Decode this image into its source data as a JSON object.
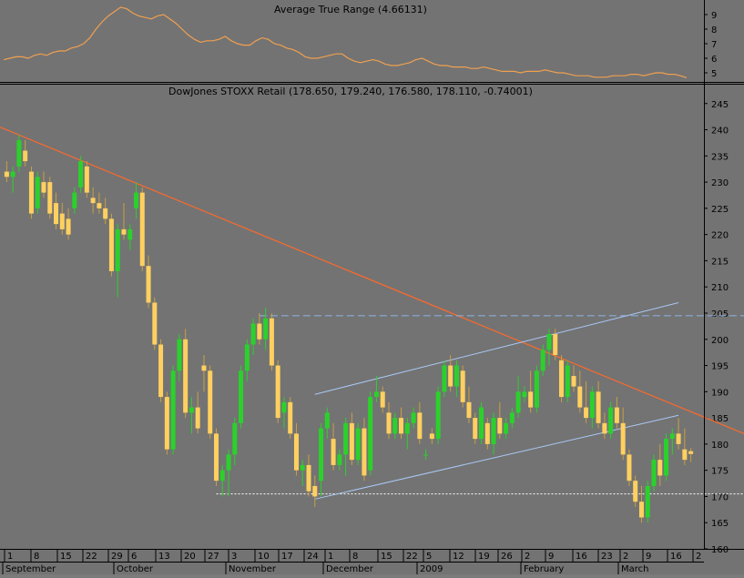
{
  "colors": {
    "background": "#737373",
    "atr_line": "#f0a050",
    "up_candle": "#2bd12b",
    "down_candle": "#ffd060",
    "trendline": "#ff6a2a",
    "channel": "#a9c8f5",
    "resistance": "#8db4e6",
    "support": "#ffffff",
    "axis_text": "#000000"
  },
  "atr_panel": {
    "title": "Average True Range (4.66131)",
    "ticks": [
      "9",
      "8",
      "7",
      "6",
      "5"
    ]
  },
  "price_panel": {
    "title": "DowJones STOXX Retail (178.650, 179.240, 176.580, 178.110, -0.74001)",
    "ticks": [
      "245",
      "240",
      "235",
      "230",
      "225",
      "220",
      "215",
      "210",
      "205",
      "200",
      "195",
      "190",
      "185",
      "180",
      "175",
      "170",
      "165",
      "160"
    ]
  },
  "x_axis": {
    "day_labels": [
      "1",
      "8",
      "15",
      "22",
      "29",
      "6",
      "13",
      "20",
      "27",
      "3",
      "10",
      "17",
      "24",
      "1",
      "8",
      "15",
      "22",
      "5",
      "12",
      "19",
      "26",
      "2",
      "9",
      "16",
      "23",
      "2",
      "9",
      "16",
      "2"
    ],
    "month_labels": [
      "September",
      "October",
      "November",
      "December",
      "2009",
      "February",
      "March"
    ]
  },
  "chart_data": {
    "type": "candlestick",
    "title": "DowJones STOXX Retail (178.650, 179.240, 176.580, 178.110, -0.74001)",
    "last_bar": {
      "open": 178.65,
      "high": 179.24,
      "low": 176.58,
      "close": 178.11,
      "change": -0.74001
    },
    "y_range": [
      160,
      246
    ],
    "atr": {
      "title": "Average True Range (4.66131)",
      "last_value": 4.66131,
      "y_range": [
        4.5,
        9.5
      ],
      "values": [
        5.9,
        6.0,
        6.1,
        6.1,
        6.0,
        6.2,
        6.3,
        6.2,
        6.4,
        6.5,
        6.5,
        6.7,
        6.8,
        7.0,
        7.4,
        8.0,
        8.5,
        8.9,
        9.2,
        9.5,
        9.4,
        9.1,
        8.9,
        8.8,
        8.7,
        8.9,
        9.0,
        8.7,
        8.4,
        8.0,
        7.6,
        7.3,
        7.1,
        7.2,
        7.2,
        7.3,
        7.5,
        7.2,
        7.0,
        6.9,
        6.9,
        7.2,
        7.4,
        7.3,
        7.0,
        6.9,
        6.7,
        6.6,
        6.4,
        6.1,
        6.0,
        6.0,
        6.1,
        6.2,
        6.3,
        6.3,
        6.0,
        5.8,
        5.7,
        5.8,
        5.9,
        5.8,
        5.6,
        5.5,
        5.5,
        5.6,
        5.7,
        5.9,
        6.0,
        5.8,
        5.6,
        5.5,
        5.5,
        5.4,
        5.4,
        5.4,
        5.3,
        5.3,
        5.4,
        5.3,
        5.2,
        5.1,
        5.1,
        5.1,
        5.0,
        5.1,
        5.1,
        5.1,
        5.2,
        5.1,
        5.0,
        5.0,
        4.9,
        4.8,
        4.8,
        4.8,
        4.7,
        4.7,
        4.7,
        4.8,
        4.8,
        4.8,
        4.9,
        4.9,
        4.8,
        4.9,
        5.0,
        5.0,
        4.9,
        4.9,
        4.8,
        4.66
      ]
    },
    "trendline": {
      "start": 240.5,
      "end": 182.0
    },
    "resistance": 204.5,
    "support": 170.5,
    "channel_upper": {
      "start": 189.5,
      "end": 207.0
    },
    "channel_lower": {
      "start": 169.5,
      "end": 185.5
    },
    "candles": [
      [
        232,
        234,
        230,
        231
      ],
      [
        231,
        233,
        228,
        232
      ],
      [
        233,
        239,
        232,
        238
      ],
      [
        236,
        238,
        233,
        234
      ],
      [
        232,
        233,
        223,
        224
      ],
      [
        225,
        232,
        224,
        231
      ],
      [
        230,
        232,
        227,
        228
      ],
      [
        230,
        231,
        223,
        224
      ],
      [
        226,
        228,
        221,
        222
      ],
      [
        224,
        226,
        220,
        221
      ],
      [
        223,
        225,
        219,
        220
      ],
      [
        225,
        229,
        224,
        228
      ],
      [
        229,
        235,
        228,
        234
      ],
      [
        233,
        234,
        227,
        228
      ],
      [
        227,
        229,
        224,
        226
      ],
      [
        226,
        228,
        224,
        225
      ],
      [
        225,
        227,
        222,
        223
      ],
      [
        223,
        224,
        212,
        213
      ],
      [
        213,
        222,
        208,
        221
      ],
      [
        221,
        226,
        219,
        220
      ],
      [
        219,
        222,
        217,
        221
      ],
      [
        225,
        230,
        223,
        228
      ],
      [
        228,
        229,
        213,
        214
      ],
      [
        214,
        216,
        206,
        207
      ],
      [
        207,
        208,
        198,
        199
      ],
      [
        199,
        200,
        188,
        189
      ],
      [
        189,
        190,
        178,
        179
      ],
      [
        179,
        195,
        178,
        194
      ],
      [
        194,
        201,
        192,
        200
      ],
      [
        200,
        202,
        185,
        186
      ],
      [
        186,
        189,
        182,
        187
      ],
      [
        187,
        190,
        182,
        183
      ],
      [
        195,
        197,
        190,
        194
      ],
      [
        194,
        195,
        181,
        182
      ],
      [
        182,
        183,
        172,
        173
      ],
      [
        173,
        176,
        170,
        175
      ],
      [
        175,
        179,
        170,
        178
      ],
      [
        178,
        185,
        176,
        184
      ],
      [
        184,
        195,
        183,
        194
      ],
      [
        194,
        200,
        192,
        199
      ],
      [
        199,
        204,
        197,
        203
      ],
      [
        203,
        205,
        199,
        200
      ],
      [
        200,
        206,
        198,
        204
      ],
      [
        204,
        205,
        194,
        195
      ],
      [
        195,
        196,
        184,
        185
      ],
      [
        186,
        189,
        183,
        188
      ],
      [
        188,
        189,
        181,
        182
      ],
      [
        182,
        184,
        174,
        175
      ],
      [
        175,
        177,
        172,
        176
      ],
      [
        176,
        178,
        170,
        171
      ],
      [
        172,
        174,
        168,
        170
      ],
      [
        173,
        184,
        170,
        183
      ],
      [
        183,
        187,
        181,
        186
      ],
      [
        181,
        184,
        175,
        176
      ],
      [
        176,
        179,
        175,
        178
      ],
      [
        178,
        185,
        174,
        184
      ],
      [
        184,
        186,
        176,
        177
      ],
      [
        177,
        184,
        176,
        183
      ],
      [
        183,
        185,
        173,
        174
      ],
      [
        175,
        190,
        174,
        189
      ],
      [
        189,
        193,
        188,
        190
      ],
      [
        190,
        191,
        186,
        187
      ],
      [
        186,
        188,
        181,
        182
      ],
      [
        182,
        186,
        181,
        185
      ],
      [
        185,
        187,
        181,
        182
      ],
      [
        182,
        185,
        179,
        184
      ],
      [
        184,
        187,
        183,
        186
      ],
      [
        186,
        188,
        180,
        181
      ],
      [
        178,
        179,
        177,
        178
      ],
      [
        182,
        183,
        180,
        181
      ],
      [
        181,
        191,
        180,
        190
      ],
      [
        190,
        196,
        189,
        195
      ],
      [
        195,
        197,
        190,
        191
      ],
      [
        191,
        196,
        189,
        195
      ],
      [
        194,
        195,
        187,
        188
      ],
      [
        188,
        191,
        184,
        185
      ],
      [
        185,
        186,
        180,
        181
      ],
      [
        181,
        188,
        180,
        187
      ],
      [
        184,
        185,
        179,
        180
      ],
      [
        180,
        186,
        178,
        185
      ],
      [
        185,
        188,
        181,
        182
      ],
      [
        182,
        185,
        181,
        184
      ],
      [
        184,
        187,
        183,
        186
      ],
      [
        186,
        193,
        185,
        190
      ],
      [
        189,
        191,
        188,
        190
      ],
      [
        190,
        194,
        186,
        187
      ],
      [
        187,
        195,
        186,
        194
      ],
      [
        194,
        199,
        193,
        198
      ],
      [
        198,
        202,
        195,
        201
      ],
      [
        201,
        202,
        196,
        197
      ],
      [
        196,
        197,
        188,
        189
      ],
      [
        189,
        196,
        188,
        195
      ],
      [
        193,
        195,
        190,
        191
      ],
      [
        191,
        194,
        186,
        187
      ],
      [
        187,
        192,
        184,
        185
      ],
      [
        185,
        191,
        183,
        190
      ],
      [
        190,
        192,
        183,
        184
      ],
      [
        184,
        186,
        181,
        182
      ],
      [
        182,
        188,
        181,
        187
      ],
      [
        187,
        189,
        183,
        184
      ],
      [
        184,
        187,
        177,
        178
      ],
      [
        178,
        179,
        172,
        173
      ],
      [
        173,
        174,
        168,
        169
      ],
      [
        169,
        172,
        165,
        166
      ],
      [
        166,
        173,
        165,
        172
      ],
      [
        172,
        178,
        171,
        177
      ],
      [
        177,
        180,
        172,
        174
      ],
      [
        174,
        182,
        173,
        181
      ],
      [
        181,
        183,
        178,
        182
      ],
      [
        182,
        185,
        179,
        180
      ],
      [
        179,
        183,
        176,
        177
      ],
      [
        178.65,
        179.24,
        176.58,
        178.11
      ]
    ]
  }
}
